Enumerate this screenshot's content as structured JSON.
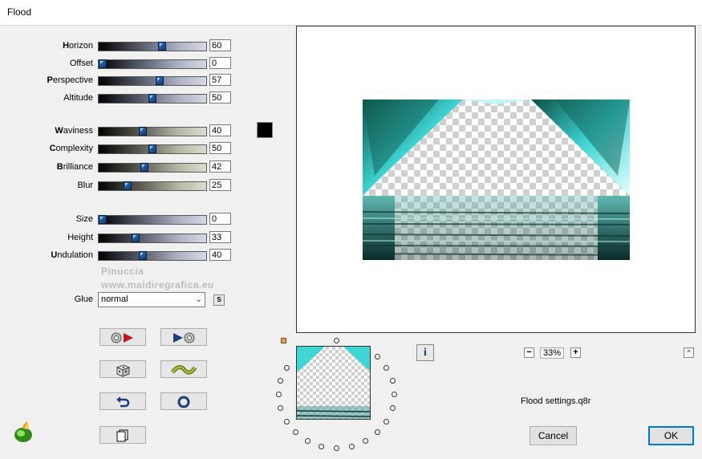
{
  "window": {
    "title": "Flood"
  },
  "sliders": [
    {
      "key": "horizon",
      "label": "Horizon",
      "hotkey_pre": "",
      "hotkey": "H",
      "hotkey_post": "orizon",
      "value": "60",
      "level": 0.6,
      "style": "gray"
    },
    {
      "key": "offset",
      "label": "Offset",
      "hotkey_pre": "Offset",
      "hotkey": "",
      "hotkey_post": "",
      "value": "0",
      "level": 0.0,
      "style": "gray"
    },
    {
      "key": "perspective",
      "label": "Perspective",
      "hotkey_pre": "",
      "hotkey": "P",
      "hotkey_post": "erspective",
      "value": "57",
      "level": 0.57,
      "style": "gray"
    },
    {
      "key": "altitude",
      "label": "Altitude",
      "hotkey_pre": "Altitude",
      "hotkey": "",
      "hotkey_post": "",
      "value": "50",
      "level": 0.5,
      "style": "gray"
    },
    {
      "key": "waviness",
      "label": "Waviness",
      "hotkey_pre": "",
      "hotkey": "W",
      "hotkey_post": "aviness",
      "value": "40",
      "level": 0.4,
      "style": "beige"
    },
    {
      "key": "complexity",
      "label": "Complexity",
      "hotkey_pre": "",
      "hotkey": "C",
      "hotkey_post": "omplexity",
      "value": "50",
      "level": 0.5,
      "style": "beige"
    },
    {
      "key": "brilliance",
      "label": "Brilliance",
      "hotkey_pre": "",
      "hotkey": "B",
      "hotkey_post": "rilliance",
      "value": "42",
      "level": 0.42,
      "style": "beige"
    },
    {
      "key": "blur",
      "label": "Blur",
      "hotkey_pre": "Blur",
      "hotkey": "",
      "hotkey_post": "",
      "value": "25",
      "level": 0.25,
      "style": "beige"
    },
    {
      "key": "size",
      "label": "Size",
      "hotkey_pre": "Size",
      "hotkey": "",
      "hotkey_post": "",
      "value": "0",
      "level": 0.0,
      "style": "gray"
    },
    {
      "key": "height",
      "label": "Height",
      "hotkey_pre": "Height",
      "hotkey": "",
      "hotkey_post": "",
      "value": "33",
      "level": 0.33,
      "style": "gray"
    },
    {
      "key": "undulation",
      "label": "Undulation",
      "hotkey_pre": "",
      "hotkey": "U",
      "hotkey_post": "ndulation",
      "value": "40",
      "level": 0.4,
      "style": "gray"
    }
  ],
  "color_swatch": {
    "color": "#000000"
  },
  "glue": {
    "label": "Glue",
    "value": "normal",
    "s_label": "S"
  },
  "watermark": {
    "line1": "Pinuccia",
    "line2": "www.maidiregrafica.eu"
  },
  "zoom": {
    "value": "33%",
    "minus": "−",
    "plus": "+"
  },
  "info_label": "i",
  "up_label": "^",
  "settings_file": "Flood settings.q8r",
  "buttons": {
    "cancel": "Cancel",
    "ok": "OK"
  },
  "icons": [
    "reset-forward-icon",
    "play-reset-icon",
    "dice-icon",
    "wave-icon",
    "undo-icon",
    "circle-icon",
    "copy-icon",
    "flaming-pear-logo-icon"
  ],
  "colors": {
    "accent": "#0078d7",
    "teal": "#3fd5d5"
  }
}
